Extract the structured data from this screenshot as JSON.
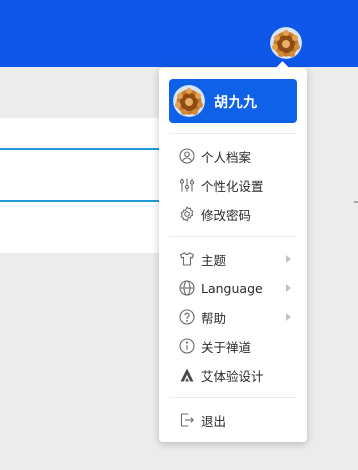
{
  "user": {
    "name": "胡九九"
  },
  "menu": {
    "profile_group": [
      {
        "label": "个人档案",
        "icon": "user-circle-icon"
      },
      {
        "label": "个性化设置",
        "icon": "sliders-icon"
      },
      {
        "label": "修改密码",
        "icon": "gear-icon"
      }
    ],
    "settings_group": [
      {
        "label": "主题",
        "icon": "tshirt-icon",
        "has_submenu": true
      },
      {
        "label": "Language",
        "icon": "globe-icon",
        "has_submenu": true
      },
      {
        "label": "帮助",
        "icon": "question-circle-icon",
        "has_submenu": true
      },
      {
        "label": "关于禅道",
        "icon": "info-circle-icon",
        "has_submenu": false
      },
      {
        "label": "艾体验设计",
        "icon": "brand-a-icon",
        "has_submenu": false
      }
    ],
    "logout": {
      "label": "退出",
      "icon": "logout-icon"
    }
  },
  "colors": {
    "header_blue": "#0f57e8",
    "user_card_blue": "#0f62e8",
    "accent_line": "#1f9bd7"
  }
}
